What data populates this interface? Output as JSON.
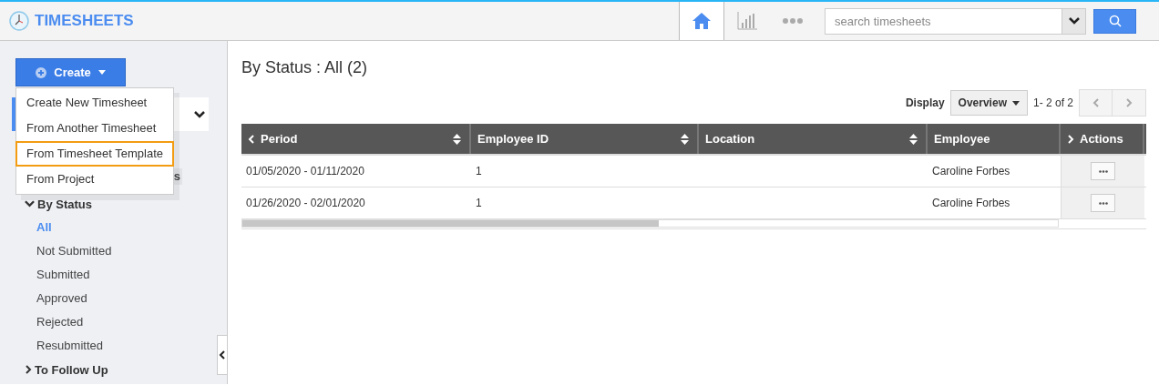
{
  "header": {
    "title": "TIMESHEETS",
    "nav": [
      {
        "kind": "home",
        "selected": true
      },
      {
        "kind": "chart",
        "selected": false
      },
      {
        "kind": "more",
        "selected": false
      }
    ],
    "search": {
      "placeholder": "search timesheets"
    }
  },
  "sidebar": {
    "create_button": "Create",
    "create_menu": [
      {
        "label": "Create New Timesheet",
        "selected": false
      },
      {
        "label": "From Another Timesheet",
        "selected": false
      },
      {
        "label": "From Timesheet Template",
        "selected": true
      },
      {
        "label": "From Project",
        "selected": false
      }
    ],
    "partial_heading": "s",
    "sections": [
      {
        "label": "By Status",
        "expanded": true,
        "items": [
          {
            "label": "All",
            "selected": true
          },
          {
            "label": "Not Submitted",
            "selected": false
          },
          {
            "label": "Submitted",
            "selected": false
          },
          {
            "label": "Approved",
            "selected": false
          },
          {
            "label": "Rejected",
            "selected": false
          },
          {
            "label": "Resubmitted",
            "selected": false
          }
        ]
      },
      {
        "label": "To Follow Up",
        "expanded": false
      }
    ]
  },
  "main": {
    "heading": "By Status : All (2)",
    "display_label": "Display",
    "display_value": "Overview",
    "pagination": "1- 2 of 2",
    "table": {
      "columns": [
        {
          "label": "Period",
          "sortable": true,
          "scroll_left": true,
          "scroll_right": false
        },
        {
          "label": "Employee ID",
          "sortable": true,
          "scroll_left": false,
          "scroll_right": false
        },
        {
          "label": "Location",
          "sortable": true,
          "scroll_left": false,
          "scroll_right": false
        },
        {
          "label": "Employee",
          "sortable": false,
          "scroll_left": false,
          "scroll_right": false
        },
        {
          "label": "Actions",
          "sortable": false,
          "scroll_left": false,
          "scroll_right": true
        }
      ],
      "rows": [
        {
          "period": "01/05/2020 - 01/11/2020",
          "employee_id": "1",
          "employee": "Caroline Forbes"
        },
        {
          "period": "01/26/2020 - 02/01/2020",
          "employee_id": "1",
          "employee": "Caroline Forbes"
        }
      ]
    }
  }
}
